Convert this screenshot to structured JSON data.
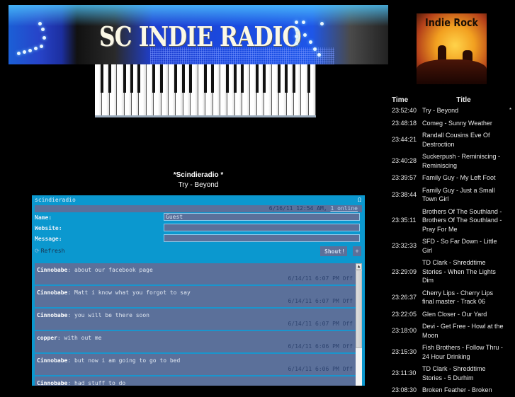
{
  "banner": {
    "title": "SC INDIE RADIO"
  },
  "now_playing": {
    "station": "*Scindieradio *",
    "track": "Try - Beyond"
  },
  "shoutbox": {
    "name": "scindieradio",
    "header_icon": "Ω",
    "status_datetime": "6/16/11 12:54 AM,",
    "online_link": "1 online",
    "fields": {
      "name_label": "Name:",
      "name_value": "Guest",
      "website_label": "Website:",
      "website_value": "",
      "message_label": "Message:",
      "message_value": ""
    },
    "refresh_label": "Refresh",
    "refresh_icon": "⟳",
    "shout_label": "Shout!",
    "plus_label": "+",
    "scroll_up": "▲",
    "messages": [
      {
        "user": "Cinnobabe",
        "text": "about our facebook page",
        "time": "6/14/11 6:07 PM Off"
      },
      {
        "user": "Cinnobabe",
        "text": "Matt i know what you forgot to say",
        "time": "6/14/11 6:07 PM Off"
      },
      {
        "user": "Cinnobabe",
        "text": "you will be there soon",
        "time": "6/14/11 6:07 PM Off"
      },
      {
        "user": "copper",
        "text": "with out me",
        "time": "6/14/11 6:06 PM Off"
      },
      {
        "user": "Cinnobabe",
        "text": "but now i am going to go to bed",
        "time": "6/14/11 6:06 PM Off"
      },
      {
        "user": "Cinnobabe",
        "text": "had stuff to do",
        "time": ""
      }
    ]
  },
  "album_art": {
    "label": "Indie Rock"
  },
  "playlist": {
    "headers": {
      "time": "Time",
      "title": "Title"
    },
    "current_marker": "*",
    "rows": [
      {
        "time": "23:52:40",
        "title": "Try - Beyond"
      },
      {
        "time": "23:48:18",
        "title": "Comeg - Sunny Weather"
      },
      {
        "time": "23:44:21",
        "title": "Randall Cousins Eve Of Destroction"
      },
      {
        "time": "23:40:28",
        "title": "Suckerpush - Reminiscing - Reminiscing"
      },
      {
        "time": "23:39:57",
        "title": "Family Guy - My Left Foot"
      },
      {
        "time": "23:38:44",
        "title": "Family Guy - Just a Small Town Girl"
      },
      {
        "time": "23:35:11",
        "title": "Brothers Of The Southland - Brothers Of The Southland - Pray For Me"
      },
      {
        "time": "23:32:33",
        "title": "SFD - So Far Down - Little Girl"
      },
      {
        "time": "23:29:09",
        "title": "TD Clark - Shreddtime Stories - When The Lights Dim"
      },
      {
        "time": "23:26:37",
        "title": "Cherry Lips - Cherry Lips final master - Track 06"
      },
      {
        "time": "23:22:05",
        "title": "Glen Closer - Our Yard"
      },
      {
        "time": "23:18:00",
        "title": "Devi - Get Free - Howl at the Moon"
      },
      {
        "time": "23:15:30",
        "title": "Fish Brothers - Follow Thru - 24 Hour Drinking"
      },
      {
        "time": "23:11:30",
        "title": "TD Clark - Shreddtime Stories - 5 Durhim"
      },
      {
        "time": "23:08:30",
        "title": "Broken Feather - Broken"
      }
    ]
  }
}
